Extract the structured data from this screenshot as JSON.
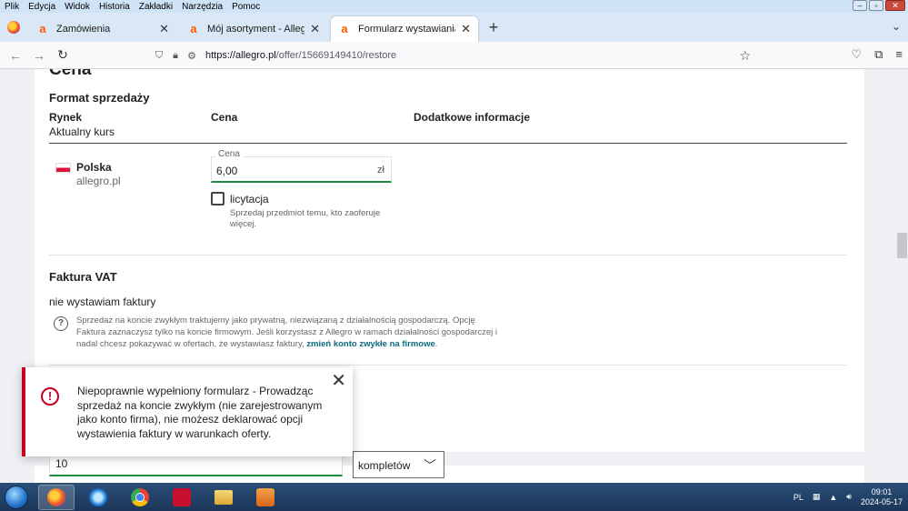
{
  "menubar": {
    "items": [
      "Plik",
      "Edycja",
      "Widok",
      "Historia",
      "Zakładki",
      "Narzędzia",
      "Pomoc"
    ]
  },
  "tabs": [
    {
      "title": "Zamówienia",
      "favicon": "a"
    },
    {
      "title": "Mój asortyment - Allegro",
      "favicon": "a"
    },
    {
      "title": "Formularz wystawiania",
      "favicon": "a"
    }
  ],
  "nav": {
    "url_host": "https://allegro.pl",
    "url_path": "/offer/15669149410/restore"
  },
  "page": {
    "section_title": "Cena",
    "format_title": "Format sprzedaży",
    "columns": {
      "market": "Rynek",
      "price": "Cena",
      "extra": "Dodatkowe informacje"
    },
    "market_sub": "Aktualny kurs",
    "market_row": {
      "country": "Polska",
      "site": "allegro.pl"
    },
    "price_field": {
      "label": "Cena",
      "value": "6,00",
      "unit": "zł"
    },
    "auction": {
      "label": "licytacja",
      "help": "Sprzedaj przedmiot temu, kto zaoferuje więcej.",
      "checked": false
    },
    "vat": {
      "title": "Faktura VAT",
      "value": "nie wystawiam faktury",
      "help_text": "Sprzedaż na koncie zwykłym traktujemy jako prywatną, niezwiązaną z działalnością gospodarczą. Opcję Faktura zaznaczysz tylko na koncie firmowym. Jeśli korzystasz z Allegro w ramach działalności gospodarczej i nadal chcesz pokazywać w ofertach, że wystawiasz faktury,",
      "help_link": "zmień konto zwykłe na firmowe",
      "help_end": "."
    },
    "quantity": {
      "value": "10",
      "unit": "kompletów"
    }
  },
  "toast": {
    "message": "Niepoprawnie wypełniony formularz - Prowadząc sprzedaż na koncie zwykłym (nie zarejestrowanym jako konto firma), nie możesz deklarować opcji wystawienia faktury w warunkach oferty."
  },
  "taskbar": {
    "lang": "PL",
    "time": "09:01",
    "date": "2024-05-17"
  },
  "colors": {
    "accent_green": "#1a8b3d",
    "error_red": "#c5001e",
    "allegro_orange": "#ff5a00",
    "link_teal": "#0b6b7f"
  }
}
